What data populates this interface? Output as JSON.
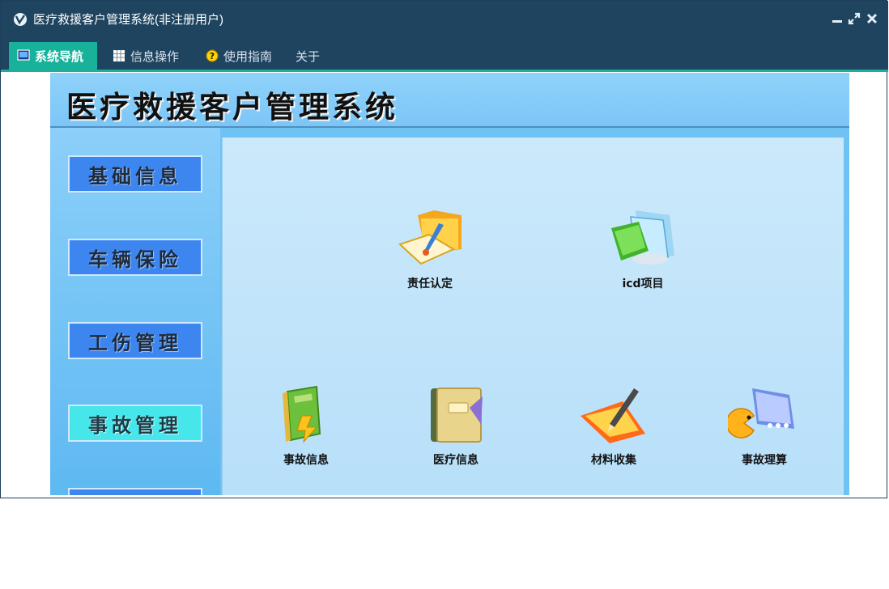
{
  "window": {
    "title": "医疗救援客户管理系统(非注册用户)",
    "icons": [
      "app-logo-icon",
      "minimize-icon",
      "restore-icon",
      "close-icon"
    ]
  },
  "menu": [
    {
      "label": "系统导航",
      "icon": "monitor-icon",
      "active": true
    },
    {
      "label": "信息操作",
      "icon": "grid-icon",
      "active": false
    },
    {
      "label": "使用指南",
      "icon": "help-icon",
      "active": false
    },
    {
      "label": "关于",
      "icon": "",
      "active": false
    }
  ],
  "banner": {
    "title": "医疗救援客户管理系统"
  },
  "sidebar": [
    {
      "label": "基础信息",
      "active": false
    },
    {
      "label": "车辆保险",
      "active": false
    },
    {
      "label": "工伤管理",
      "active": false
    },
    {
      "label": "事故管理",
      "active": true
    }
  ],
  "tiles": [
    {
      "label": "责任认定",
      "icon": "folder-document-icon"
    },
    {
      "label": "icd项目",
      "icon": "folders-icon"
    },
    {
      "label": "事故信息",
      "icon": "book-icon"
    },
    {
      "label": "医疗信息",
      "icon": "notebook-icon"
    },
    {
      "label": "材料收集",
      "icon": "pen-paper-icon"
    },
    {
      "label": "事故理算",
      "icon": "calculator-icon"
    }
  ],
  "colors": {
    "titlebar": "#1f4460",
    "menu_active": "#18b19a",
    "sidebar_button": "#3d86ef",
    "sidebar_button_active": "#47e6ea"
  }
}
